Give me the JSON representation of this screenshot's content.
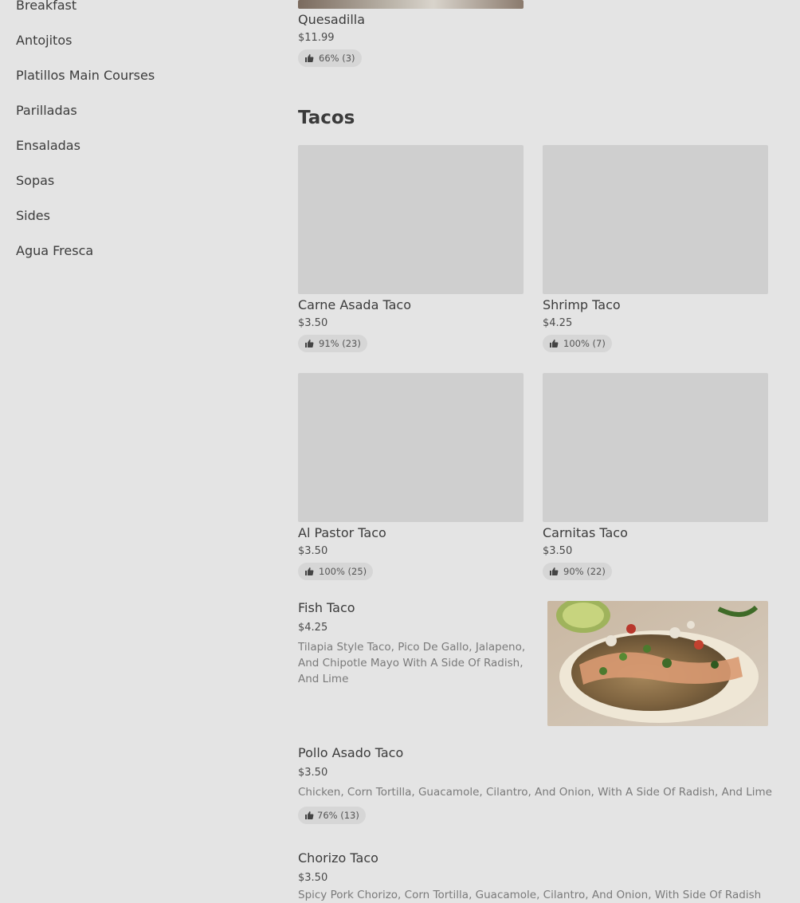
{
  "sidebar": {
    "categories": [
      "Breakfast",
      "Antojitos",
      "Platillos Main Courses",
      "Parilladas",
      "Ensaladas",
      "Sopas",
      "Sides",
      "Agua Fresca"
    ]
  },
  "prev_section": {
    "item": {
      "name": "Quesadilla",
      "price": "$11.99",
      "rating": "66% (3)"
    }
  },
  "tacos": {
    "title": "Tacos",
    "grid": [
      {
        "name": "Carne Asada Taco",
        "price": "$3.50",
        "rating": "91% (23)"
      },
      {
        "name": "Shrimp Taco",
        "price": "$4.25",
        "rating": "100% (7)"
      },
      {
        "name": "Al Pastor Taco",
        "price": "$3.50",
        "rating": "100% (25)"
      },
      {
        "name": "Carnitas Taco",
        "price": "$3.50",
        "rating": "90% (22)"
      }
    ],
    "fish": {
      "name": "Fish Taco",
      "price": "$4.25",
      "description": "Tilapia Style Taco, Pico De Gallo, Jalapeno, And Chipotle Mayo With A Side Of Radish, And Lime"
    },
    "pollo": {
      "name": "Pollo Asado Taco",
      "price": "$3.50",
      "description": "Chicken, Corn Tortilla, Guacamole, Cilantro, And Onion, With A Side Of Radish, And Lime",
      "rating": "76% (13)"
    },
    "chorizo": {
      "name": "Chorizo Taco",
      "price": "$3.50",
      "description": "Spicy Pork Chorizo, Corn Tortilla, Guacamole, Cilantro, And Onion, With Side Of Radish"
    }
  },
  "icons": {
    "rating": "thumbs-up-icon"
  }
}
